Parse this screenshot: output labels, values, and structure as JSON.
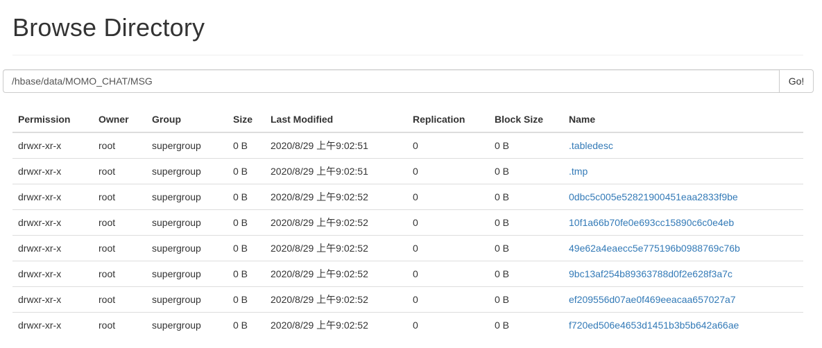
{
  "header": {
    "title": "Browse Directory"
  },
  "path_form": {
    "value": "/hbase/data/MOMO_CHAT/MSG",
    "go_label": "Go!"
  },
  "table": {
    "columns": [
      "Permission",
      "Owner",
      "Group",
      "Size",
      "Last Modified",
      "Replication",
      "Block Size",
      "Name"
    ],
    "rows": [
      {
        "permission": "drwxr-xr-x",
        "owner": "root",
        "group": "supergroup",
        "size": "0 B",
        "modified": "2020/8/29 上午9:02:51",
        "replication": "0",
        "block_size": "0 B",
        "name": ".tabledesc"
      },
      {
        "permission": "drwxr-xr-x",
        "owner": "root",
        "group": "supergroup",
        "size": "0 B",
        "modified": "2020/8/29 上午9:02:51",
        "replication": "0",
        "block_size": "0 B",
        "name": ".tmp"
      },
      {
        "permission": "drwxr-xr-x",
        "owner": "root",
        "group": "supergroup",
        "size": "0 B",
        "modified": "2020/8/29 上午9:02:52",
        "replication": "0",
        "block_size": "0 B",
        "name": "0dbc5c005e52821900451eaa2833f9be"
      },
      {
        "permission": "drwxr-xr-x",
        "owner": "root",
        "group": "supergroup",
        "size": "0 B",
        "modified": "2020/8/29 上午9:02:52",
        "replication": "0",
        "block_size": "0 B",
        "name": "10f1a66b70fe0e693cc15890c6c0e4eb"
      },
      {
        "permission": "drwxr-xr-x",
        "owner": "root",
        "group": "supergroup",
        "size": "0 B",
        "modified": "2020/8/29 上午9:02:52",
        "replication": "0",
        "block_size": "0 B",
        "name": "49e62a4eaecc5e775196b0988769c76b"
      },
      {
        "permission": "drwxr-xr-x",
        "owner": "root",
        "group": "supergroup",
        "size": "0 B",
        "modified": "2020/8/29 上午9:02:52",
        "replication": "0",
        "block_size": "0 B",
        "name": "9bc13af254b89363788d0f2e628f3a7c"
      },
      {
        "permission": "drwxr-xr-x",
        "owner": "root",
        "group": "supergroup",
        "size": "0 B",
        "modified": "2020/8/29 上午9:02:52",
        "replication": "0",
        "block_size": "0 B",
        "name": "ef209556d07ae0f469eeacaa657027a7"
      },
      {
        "permission": "drwxr-xr-x",
        "owner": "root",
        "group": "supergroup",
        "size": "0 B",
        "modified": "2020/8/29 上午9:02:52",
        "replication": "0",
        "block_size": "0 B",
        "name": "f720ed506e4653d1451b3b5b642a66ae"
      }
    ]
  },
  "colors": {
    "link": "#337ab7",
    "text": "#333333",
    "border": "#dddddd"
  }
}
